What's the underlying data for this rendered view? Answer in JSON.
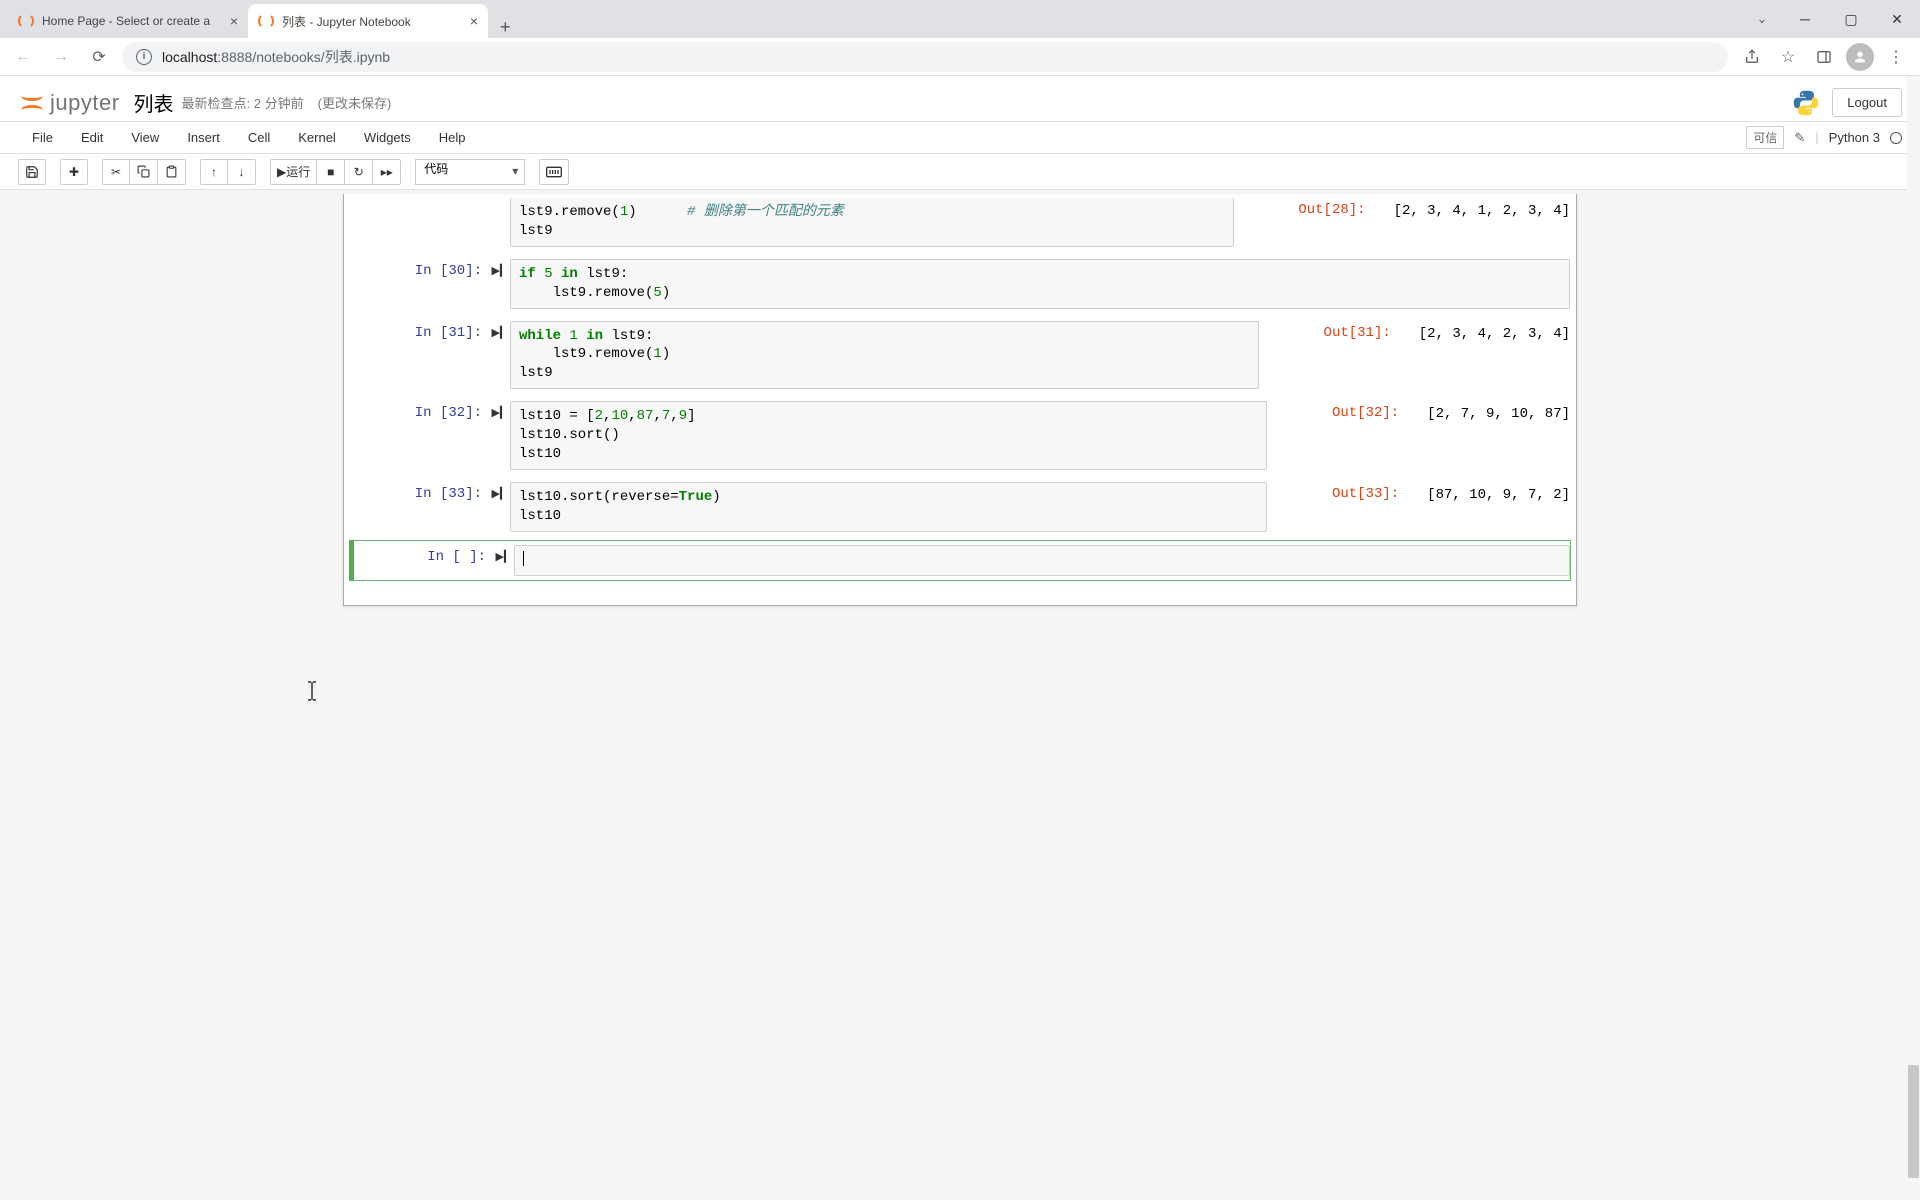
{
  "browser": {
    "tabs": [
      {
        "title": "Home Page - Select or create a",
        "active": false
      },
      {
        "title": "列表 - Jupyter Notebook",
        "active": true
      }
    ],
    "url_host": "localhost",
    "url_port": ":8888",
    "url_path": "/notebooks/列表.ipynb"
  },
  "header": {
    "logo_text": "jupyter",
    "notebook_name": "列表",
    "checkpoint": "最新检查点: 2 分钟前",
    "unsaved": "(更改未保存)",
    "logout": "Logout"
  },
  "menubar": {
    "items": [
      "File",
      "Edit",
      "View",
      "Insert",
      "Cell",
      "Kernel",
      "Widgets",
      "Help"
    ],
    "trusted": "可信",
    "kernel": "Python 3"
  },
  "toolbar": {
    "run_label": "运行",
    "celltype": "代码"
  },
  "cells": [
    {
      "in_prompt": "",
      "code_html": "lst9.remove(<span class='num'>1</span>)      <span class='cm'># 删除第一个匹配的元素</span>\nlst9",
      "out_prompt": "Out[28]:",
      "output": "[2, 3, 4, 1, 2, 3, 4]",
      "partial": true
    },
    {
      "in_prompt": "In  [30]:",
      "code_html": "<span class='kw'>if</span> <span class='num'>5</span> <span class='kw'>in</span> lst9:\n    lst9.remove(<span class='num'>5</span>)",
      "out_prompt": "",
      "output": ""
    },
    {
      "in_prompt": "In  [31]:",
      "code_html": "<span class='kw'>while</span> <span class='num'>1</span> <span class='kw'>in</span> lst9:\n    lst9.remove(<span class='num'>1</span>)\nlst9",
      "out_prompt": "Out[31]:",
      "output": "[2, 3, 4, 2, 3, 4]"
    },
    {
      "in_prompt": "In  [32]:",
      "code_html": "lst10 = [<span class='num'>2</span>,<span class='num'>10</span>,<span class='num'>87</span>,<span class='num'>7</span>,<span class='num'>9</span>]\nlst10.sort()\nlst10",
      "out_prompt": "Out[32]:",
      "output": "[2, 7, 9, 10, 87]"
    },
    {
      "in_prompt": "In  [33]:",
      "code_html": "lst10.sort(reverse=<span class='bool'>True</span>)\nlst10",
      "out_prompt": "Out[33]:",
      "output": "[87, 10, 9, 7, 2]"
    },
    {
      "in_prompt": "In  [ ]:",
      "code_html": "<span class='cursor'></span>",
      "out_prompt": "",
      "output": "",
      "selected": true
    }
  ]
}
